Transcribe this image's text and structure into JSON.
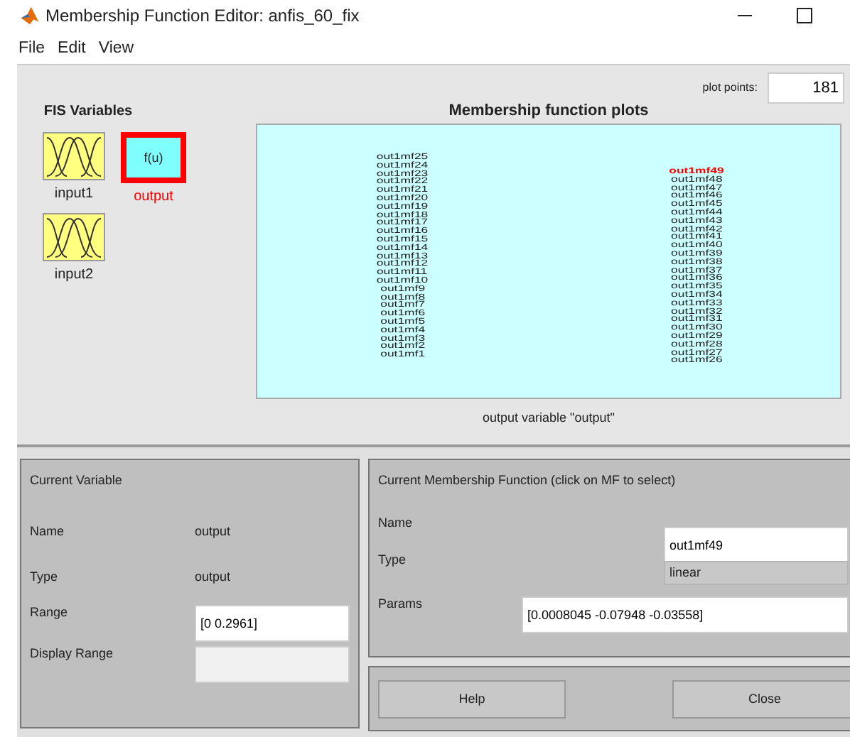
{
  "window": {
    "title": "Membership Function Editor: anfis_60_fix"
  },
  "menu": [
    "File",
    "Edit",
    "View"
  ],
  "fis_variables": {
    "title": "FIS Variables",
    "items": [
      {
        "kind": "input",
        "label": "input1",
        "selected": false
      },
      {
        "kind": "output",
        "label": "output",
        "symbol": "f(u)",
        "selected": true
      },
      {
        "kind": "input",
        "label": "input2",
        "selected": false
      }
    ]
  },
  "plot": {
    "plot_points_label": "plot points:",
    "plot_points": "181",
    "title": "Membership function plots",
    "caption": "output variable \"output\"",
    "columns": [
      [
        {
          "label": "out1mf25",
          "selected": false
        },
        {
          "label": "out1mf24",
          "selected": false
        },
        {
          "label": "out1mf23",
          "selected": false
        },
        {
          "label": "out1mf22",
          "selected": false
        },
        {
          "label": "out1mf21",
          "selected": false
        },
        {
          "label": "out1mf20",
          "selected": false
        },
        {
          "label": "out1mf19",
          "selected": false
        },
        {
          "label": "out1mf18",
          "selected": false
        },
        {
          "label": "out1mf17",
          "selected": false
        },
        {
          "label": "out1mf16",
          "selected": false
        },
        {
          "label": "out1mf15",
          "selected": false
        },
        {
          "label": "out1mf14",
          "selected": false
        },
        {
          "label": "out1mf13",
          "selected": false
        },
        {
          "label": "out1mf12",
          "selected": false
        },
        {
          "label": "out1mf11",
          "selected": false
        },
        {
          "label": "out1mf10",
          "selected": false
        },
        {
          "label": "out1mf9",
          "selected": false
        },
        {
          "label": "out1mf8",
          "selected": false
        },
        {
          "label": "out1mf7",
          "selected": false
        },
        {
          "label": "out1mf6",
          "selected": false
        },
        {
          "label": "out1mf5",
          "selected": false
        },
        {
          "label": "out1mf4",
          "selected": false
        },
        {
          "label": "out1mf3",
          "selected": false
        },
        {
          "label": "out1mf2",
          "selected": false
        },
        {
          "label": "out1mf1",
          "selected": false
        }
      ],
      [
        {
          "label": "out1mf49",
          "selected": true
        },
        {
          "label": "out1mf48",
          "selected": false
        },
        {
          "label": "out1mf47",
          "selected": false
        },
        {
          "label": "out1mf46",
          "selected": false
        },
        {
          "label": "out1mf45",
          "selected": false
        },
        {
          "label": "out1mf44",
          "selected": false
        },
        {
          "label": "out1mf43",
          "selected": false
        },
        {
          "label": "out1mf42",
          "selected": false
        },
        {
          "label": "out1mf41",
          "selected": false
        },
        {
          "label": "out1mf40",
          "selected": false
        },
        {
          "label": "out1mf39",
          "selected": false
        },
        {
          "label": "out1mf38",
          "selected": false
        },
        {
          "label": "out1mf37",
          "selected": false
        },
        {
          "label": "out1mf36",
          "selected": false
        },
        {
          "label": "out1mf35",
          "selected": false
        },
        {
          "label": "out1mf34",
          "selected": false
        },
        {
          "label": "out1mf33",
          "selected": false
        },
        {
          "label": "out1mf32",
          "selected": false
        },
        {
          "label": "out1mf31",
          "selected": false
        },
        {
          "label": "out1mf30",
          "selected": false
        },
        {
          "label": "out1mf29",
          "selected": false
        },
        {
          "label": "out1mf28",
          "selected": false
        },
        {
          "label": "out1mf27",
          "selected": false
        },
        {
          "label": "out1mf26",
          "selected": false
        }
      ]
    ]
  },
  "current_variable": {
    "title": "Current Variable",
    "name_label": "Name",
    "name": "output",
    "type_label": "Type",
    "type": "output",
    "range_label": "Range",
    "range": "[0 0.2961]",
    "display_range_label": "Display Range"
  },
  "current_mf": {
    "title": "Current Membership Function (click on MF to select)",
    "name_label": "Name",
    "name": "out1mf49",
    "type_label": "Type",
    "type": "linear",
    "params_label": "Params",
    "params": "[0.0008045 -0.07948 -0.03558]"
  },
  "buttons": [
    "Help",
    "Close"
  ]
}
